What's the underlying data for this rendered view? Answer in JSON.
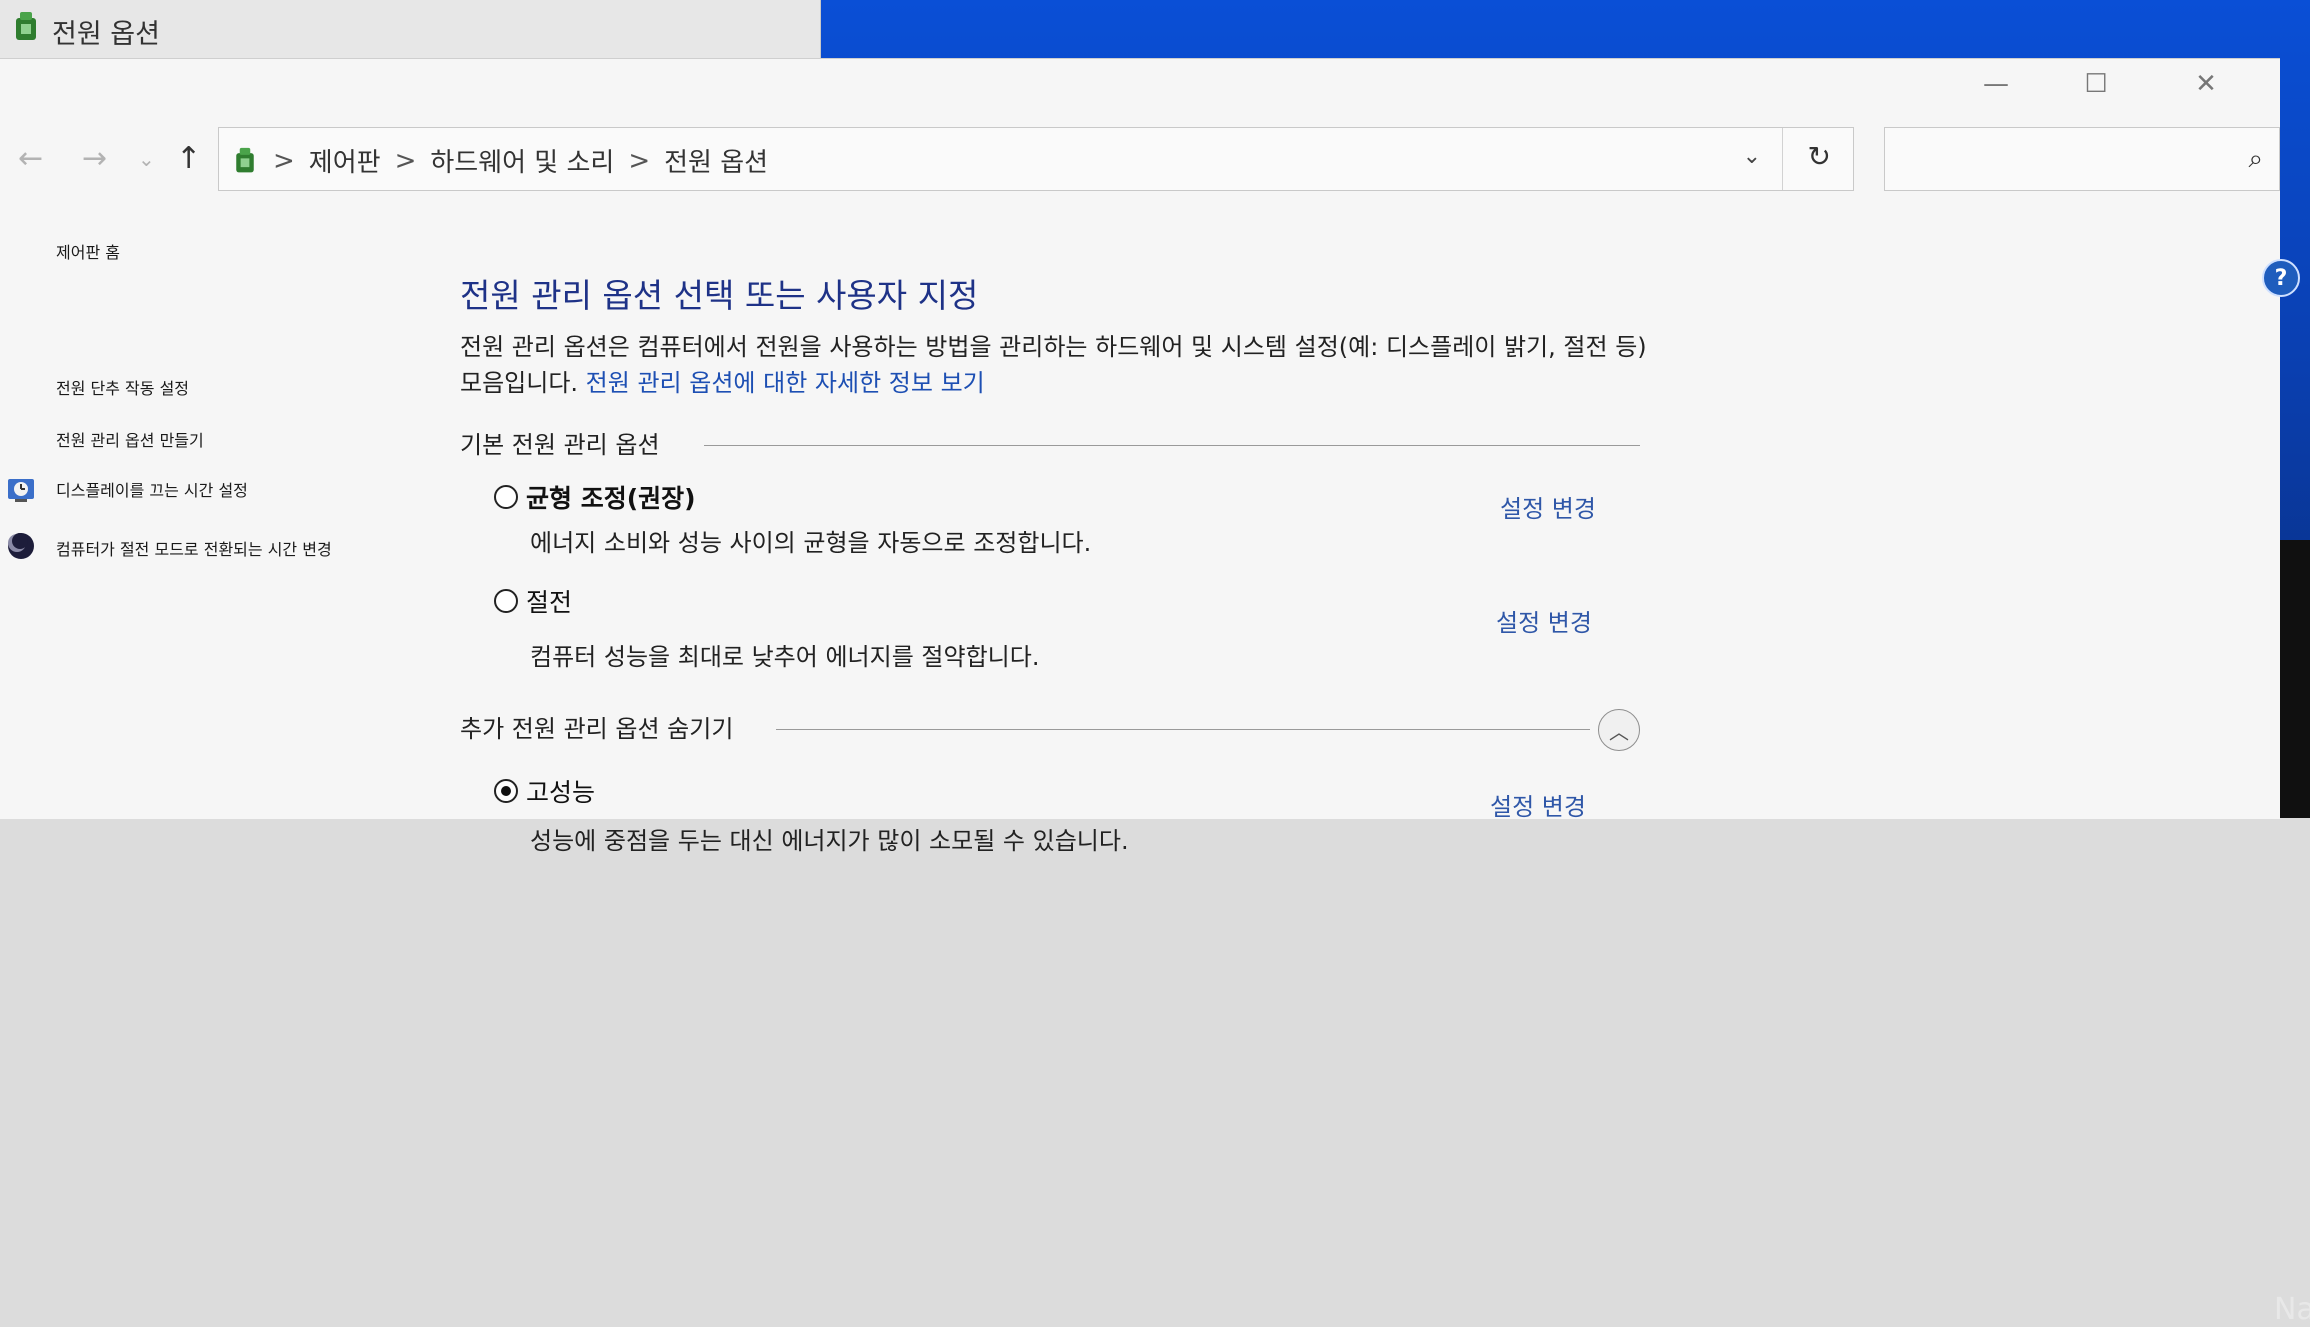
{
  "back_window": {
    "title": "전원 옵션"
  },
  "window": {
    "controls": {
      "minimize": "—",
      "maximize": "☐",
      "close": "✕"
    },
    "nav": {
      "back": "←",
      "forward": "→",
      "recent": "⌄",
      "up": "↑"
    },
    "address": {
      "crumbs": [
        "제어판",
        "하드웨어 및 소리",
        "전원 옵션"
      ],
      "separator": ">",
      "dropdown": "⌄",
      "refresh": "↻"
    },
    "search": {
      "placeholder": "",
      "icon": "⌕"
    }
  },
  "sidebar": {
    "home": "제어판 홈",
    "items": [
      {
        "label": "전원 단추 작동 설정"
      },
      {
        "label": "전원 관리 옵션 만들기"
      },
      {
        "label": "디스플레이를 끄는 시간 설정",
        "icon": "clock-icon"
      },
      {
        "label": "컴퓨터가 절전 모드로 전환되는 시간 변경",
        "icon": "moon-icon"
      }
    ]
  },
  "content": {
    "title": "전원 관리 옵션 선택 또는 사용자 지정",
    "description": "전원 관리 옵션은 컴퓨터에서 전원을 사용하는 방법을 관리하는 하드웨어 및 시스템 설정(예: 디스플레이 밝기, 절전 등) 모음입니다.",
    "description_link": "전원 관리 옵션에 대한 자세한 정보 보기",
    "basic_section": "기본 전원 관리 옵션",
    "extra_section": "추가 전원 관리 옵션 숨기기",
    "plans": [
      {
        "name": "균형 조정(권장)",
        "description": "에너지 소비와 성능 사이의 균형을 자동으로 조정합니다.",
        "selected": false,
        "change": "설정 변경"
      },
      {
        "name": "절전",
        "description": "컴퓨터 성능을 최대로 낮추어 에너지를 절약합니다.",
        "selected": false,
        "change": "설정 변경"
      },
      {
        "name": "고성능",
        "description": "성능에 중점을 두는 대신 에너지가 많이 소모될 수 있습니다.",
        "selected": true,
        "change": "설정 변경"
      }
    ],
    "help_icon": "?"
  },
  "taskbar": {
    "text": "Na"
  },
  "colors": {
    "title_blue": "#1e3287",
    "link_blue": "#2f57a8",
    "desktop_blue": "#0a4fd6"
  }
}
